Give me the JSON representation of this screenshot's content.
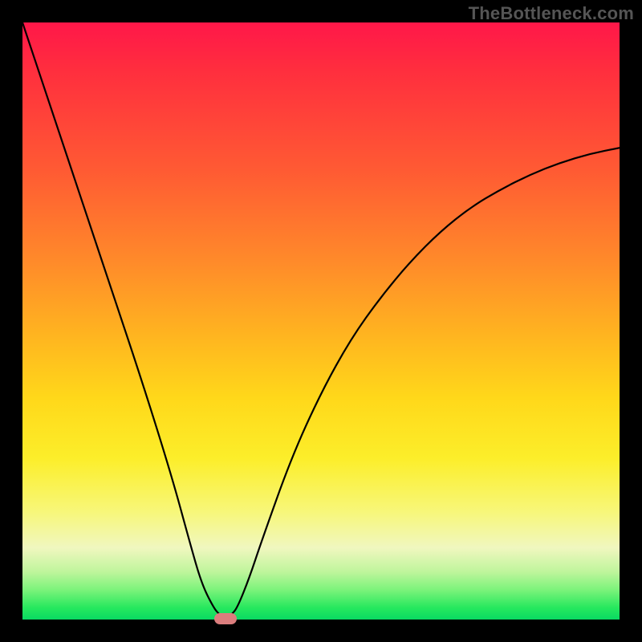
{
  "watermark": "TheBottleneck.com",
  "chart_data": {
    "type": "line",
    "title": "",
    "xlabel": "",
    "ylabel": "",
    "xlim": [
      0,
      100
    ],
    "ylim": [
      0,
      100
    ],
    "grid": false,
    "legend": false,
    "background_gradient": {
      "direction": "top-to-bottom",
      "stops": [
        {
          "pos": 0.0,
          "color": "#ff1749"
        },
        {
          "pos": 0.08,
          "color": "#ff2e3e"
        },
        {
          "pos": 0.25,
          "color": "#ff5b33"
        },
        {
          "pos": 0.4,
          "color": "#ff8a2a"
        },
        {
          "pos": 0.52,
          "color": "#ffb320"
        },
        {
          "pos": 0.63,
          "color": "#ffd81a"
        },
        {
          "pos": 0.73,
          "color": "#fcee2a"
        },
        {
          "pos": 0.82,
          "color": "#f7f77a"
        },
        {
          "pos": 0.88,
          "color": "#f0f7bf"
        },
        {
          "pos": 0.92,
          "color": "#bff59c"
        },
        {
          "pos": 0.95,
          "color": "#7cf37b"
        },
        {
          "pos": 0.98,
          "color": "#27e85e"
        },
        {
          "pos": 1.0,
          "color": "#09da62"
        }
      ]
    },
    "series": [
      {
        "name": "bottleneck-curve",
        "x": [
          0,
          5,
          10,
          15,
          20,
          25,
          28,
          30,
          32,
          33,
          34,
          35,
          36,
          38,
          40,
          45,
          50,
          55,
          60,
          65,
          70,
          75,
          80,
          85,
          90,
          95,
          100
        ],
        "y": [
          100,
          85,
          70,
          55,
          40,
          24,
          13,
          6,
          2,
          0.8,
          0,
          0.8,
          2,
          7,
          13,
          27,
          38,
          47,
          54,
          60,
          65,
          69,
          72,
          74.5,
          76.5,
          78,
          79
        ]
      }
    ],
    "markers": [
      {
        "name": "bottleneck-marker",
        "shape": "rounded-rect",
        "x": 34,
        "y": 0,
        "color": "#db7d7d"
      }
    ],
    "frame": {
      "border_color": "#000000",
      "border_width_px": 28
    }
  }
}
